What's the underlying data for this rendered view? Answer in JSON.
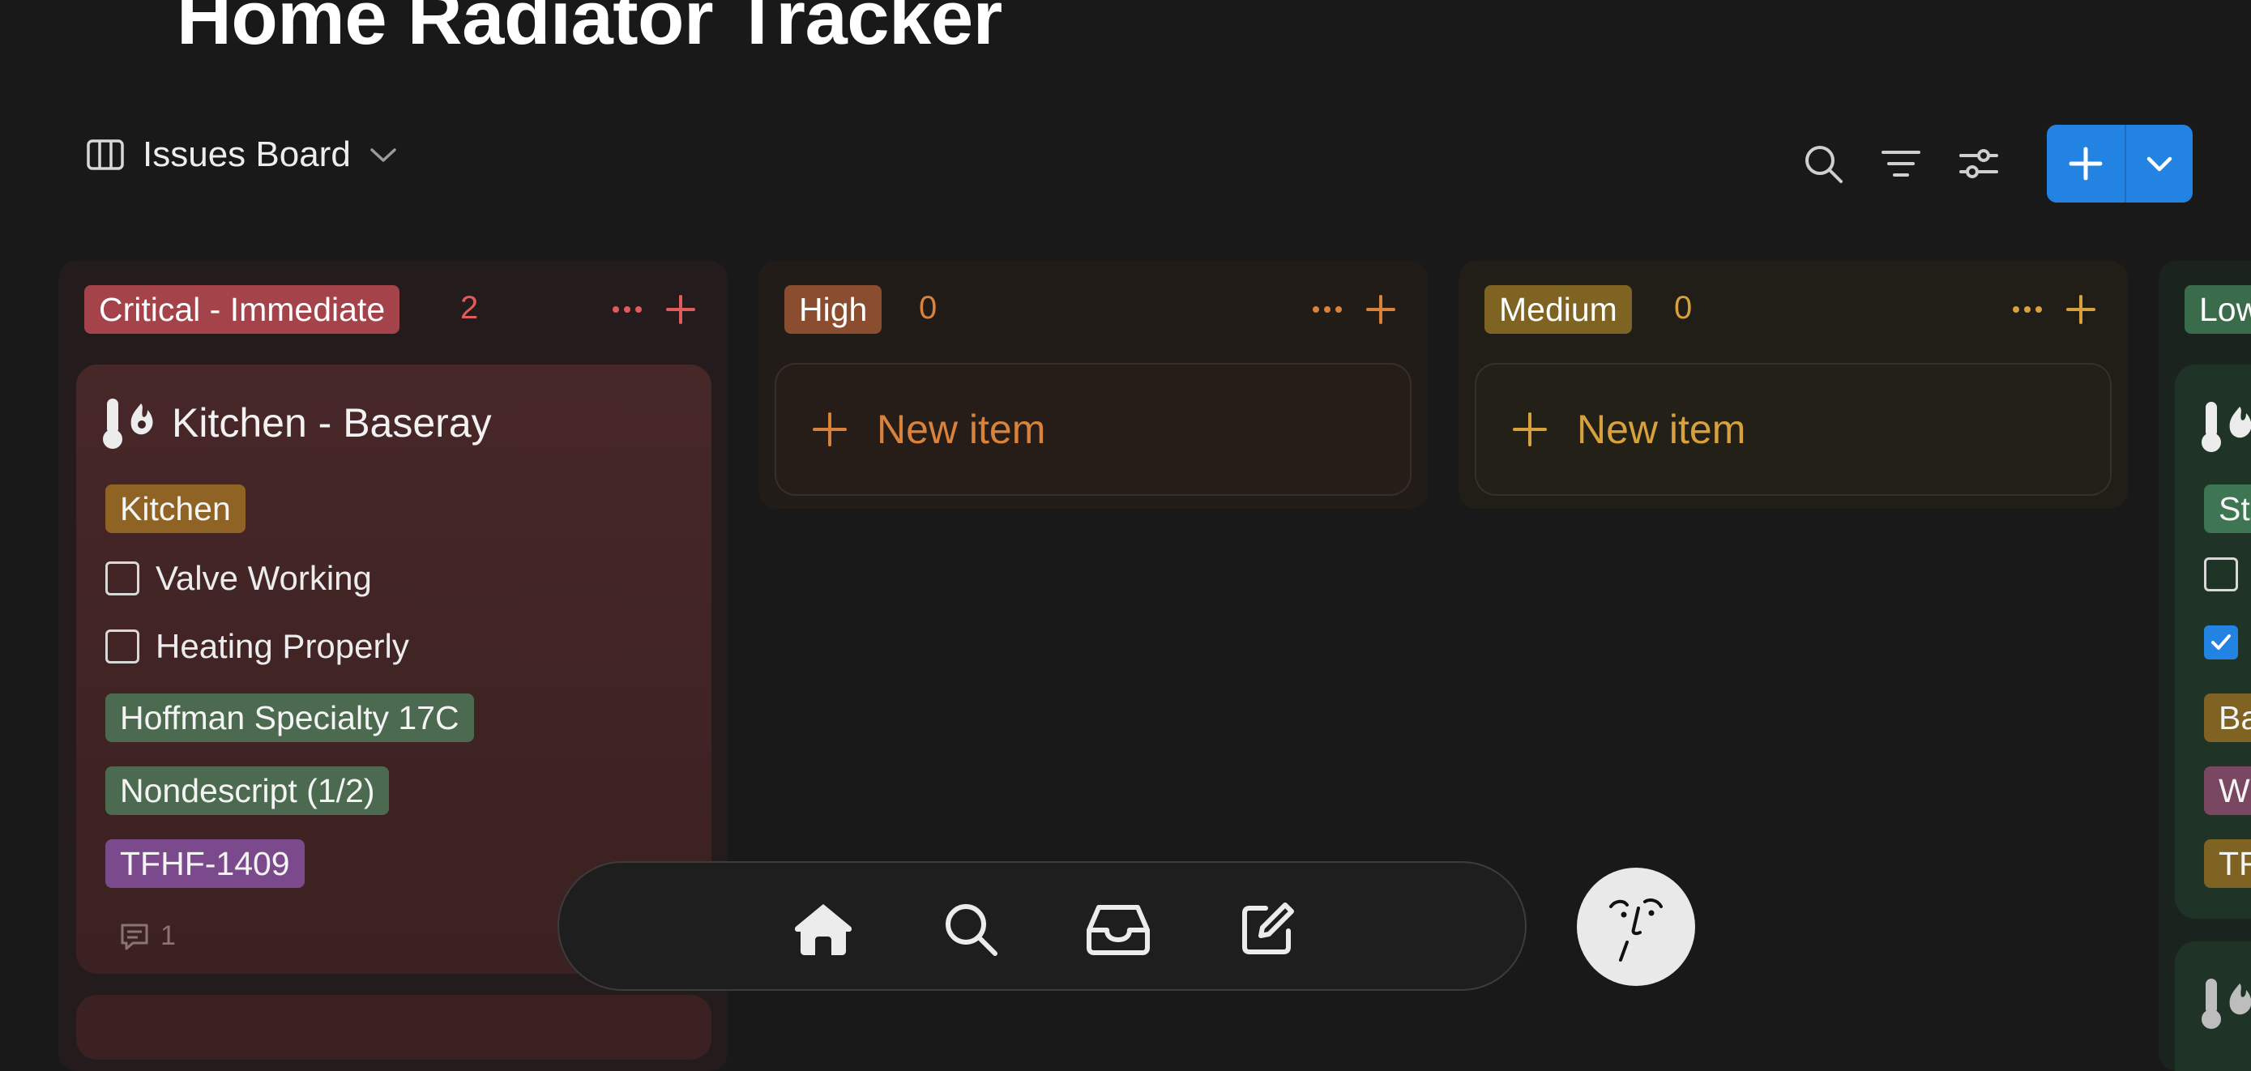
{
  "page": {
    "title": "Home Radiator Tracker"
  },
  "view": {
    "name": "Issues Board"
  },
  "toolbar": {
    "icons": [
      "search-icon",
      "filter-icon",
      "settings-sliders-icon"
    ],
    "new_button": "plus-icon",
    "new_dropdown": "chevron-down-icon"
  },
  "columns": [
    {
      "name": "Critical - Immediate",
      "count": "2",
      "pill_color": "#a4434a",
      "accent": "#e05c5c"
    },
    {
      "name": "High",
      "count": "0",
      "pill_color": "#8b4d2f",
      "accent": "#d9823c",
      "new_item": "New item"
    },
    {
      "name": "Medium",
      "count": "0",
      "pill_color": "#7f6322",
      "accent": "#d9a13d",
      "new_item": "New item"
    },
    {
      "name": "Low",
      "pill_color": "#3a6b4b"
    }
  ],
  "card": {
    "title": "Kitchen - Baseray",
    "location_tag": "Kitchen",
    "checks": [
      {
        "label": "Valve Working",
        "checked": false
      },
      {
        "label": "Heating Properly",
        "checked": false
      }
    ],
    "tags": [
      "Hoffman Specialty 17C",
      "Nondescript (1/2)",
      "TFHF-1409"
    ],
    "comments": "1"
  },
  "low_card": {
    "tags": [
      "St",
      "Ba",
      "W",
      "TF"
    ]
  },
  "bottom_nav": {
    "items": [
      "home-icon",
      "search-icon",
      "inbox-icon",
      "compose-icon"
    ]
  }
}
